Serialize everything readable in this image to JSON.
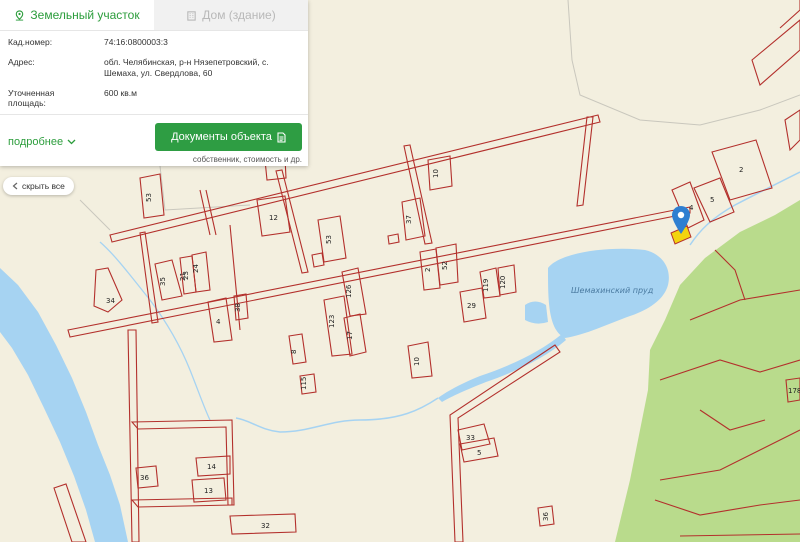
{
  "tabs": {
    "land": "Земельный участок",
    "building": "Дом (здание)"
  },
  "info": {
    "cad_label": "Кад.номер:",
    "cad_value": "74:16:0800003:3",
    "addr_label": "Адрес:",
    "addr_value": "обл. Челябинская, р-н Нязепетровский, с. Шемаха, ул. Свердлова, 60",
    "area_label": "Уточненная площадь:",
    "area_value": "600 кв.м"
  },
  "footer": {
    "more": "подробнее",
    "docs_button": "Документы объекта",
    "docs_note": "собственник, стоимость и др."
  },
  "controls": {
    "hide_all": "скрыть все"
  },
  "map": {
    "pond_label": "Шемахинский пруд",
    "parcel_labels": [
      "53",
      "12",
      "10",
      "37",
      "53",
      "2",
      "52",
      "119",
      "120",
      "29",
      "126",
      "123",
      "17",
      "8",
      "115",
      "10",
      "4",
      "38",
      "35",
      "24",
      "23",
      "21",
      "34",
      "33",
      "5",
      "14",
      "13",
      "36",
      "32",
      "36",
      "4",
      "5",
      "2",
      "178"
    ],
    "colors": {
      "water": "#a6d3f2",
      "forest": "#b9db8c",
      "land": "#f3efdf",
      "parcel": "#b3302c",
      "marker": "#2f7fd1",
      "selected": "#f3d40e"
    },
    "icons": {
      "marker": "location-pin-icon",
      "land_tab": "pin-icon",
      "building_tab": "building-icon",
      "doc": "document-icon",
      "chevron": "chevron-down-icon"
    }
  }
}
